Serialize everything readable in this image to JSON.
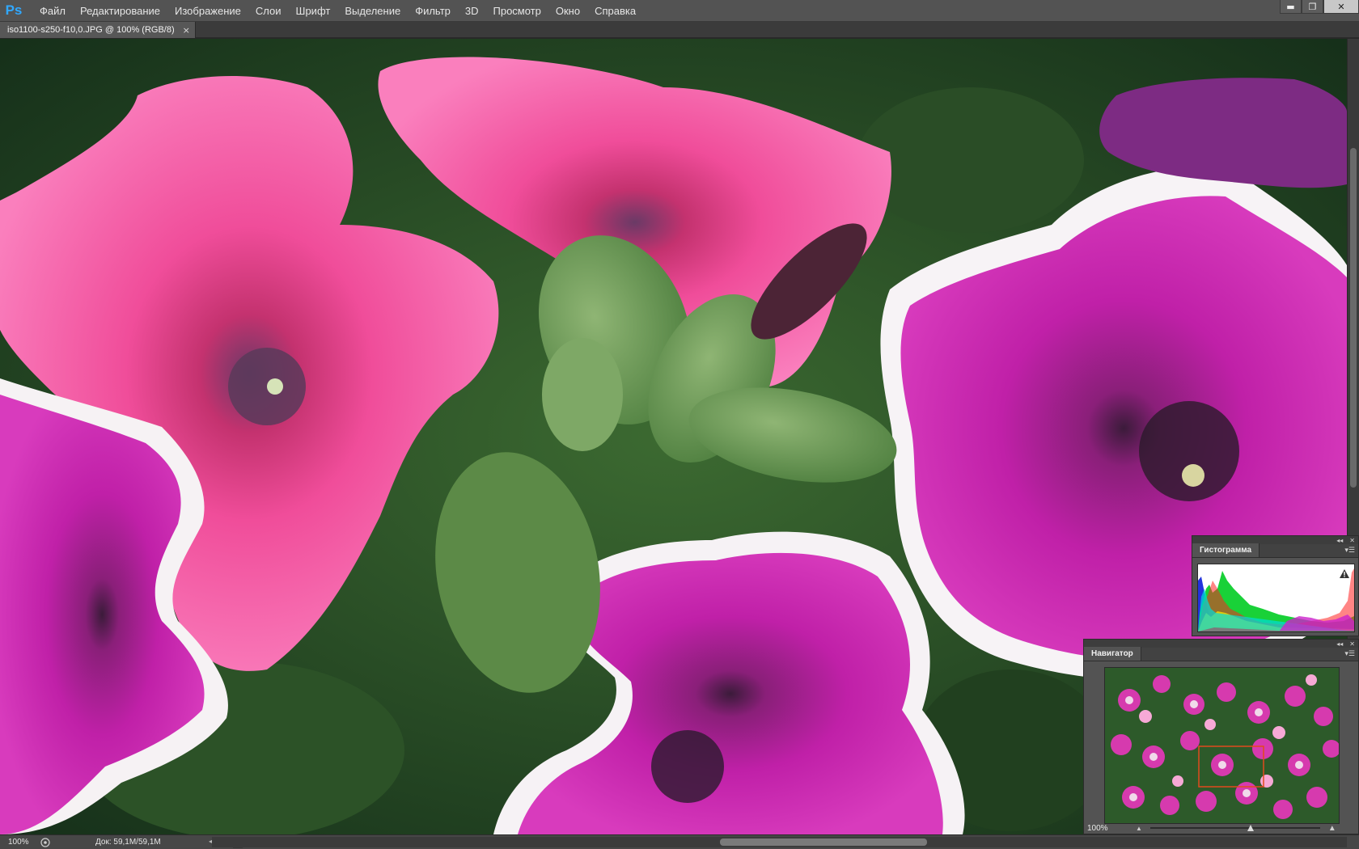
{
  "app": {
    "logo": "Ps"
  },
  "menu": {
    "items": [
      "Файл",
      "Редактирование",
      "Изображение",
      "Слои",
      "Шрифт",
      "Выделение",
      "Фильтр",
      "3D",
      "Просмотр",
      "Окно",
      "Справка"
    ]
  },
  "window_controls": {
    "minimize": "▬",
    "restore": "❐",
    "close": "✕"
  },
  "document": {
    "tab_label": "iso1100-s250-f10,0.JPG @ 100% (RGB/8)",
    "tab_close": "×"
  },
  "status": {
    "zoom": "100%",
    "doc_size": "Док: 59,1M/59,1M",
    "arrow": "▶"
  },
  "histogram_panel": {
    "collapse": "◂◂",
    "close": "✕",
    "tab": "Гистограмма",
    "menu": "▾☰",
    "warning": "!"
  },
  "navigator_panel": {
    "collapse": "◂◂",
    "close": "✕",
    "tab": "Навигатор",
    "menu": "▾☰",
    "zoom": "100%",
    "zoom_level_fraction": 0.59
  },
  "icons": {
    "logo": "photoshop-logo-icon",
    "status_info": "status-info-icon",
    "warning": "warning-icon"
  },
  "colors": {
    "accent": "#31a8ff",
    "nav_view_box": "#e24a1c"
  }
}
